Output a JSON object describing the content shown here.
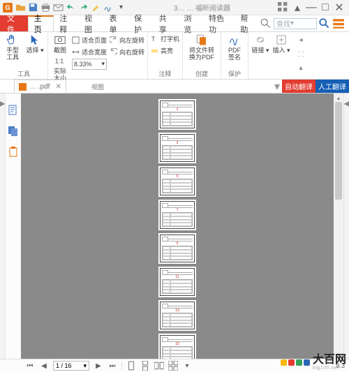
{
  "app": {
    "titleCenter": "3… … 福昕阅读器",
    "logoLetter": "G"
  },
  "quickAccess": [
    "open-icon",
    "save-icon",
    "print-icon",
    "mail-icon",
    "undo-icon",
    "redo-icon",
    "highlight-icon",
    "sign-icon",
    "more-icon"
  ],
  "windowControls": [
    "wc-grid",
    "wc-up",
    "wc-min",
    "wc-max",
    "wc-close"
  ],
  "tabStrip": {
    "file": "文件",
    "tabs": [
      {
        "id": "zhuye",
        "label": "主页",
        "active": true
      },
      {
        "id": "zhushi",
        "label": "注释"
      },
      {
        "id": "shitu",
        "label": "视图"
      },
      {
        "id": "biaodan",
        "label": "表单"
      },
      {
        "id": "baohu",
        "label": "保护"
      },
      {
        "id": "gongxiang",
        "label": "共享"
      },
      {
        "id": "liulan",
        "label": "浏览"
      },
      {
        "id": "tesegn",
        "label": "特色功"
      },
      {
        "id": "bangzhu",
        "label": "帮助"
      }
    ],
    "search": {
      "placeholder": "查找"
    }
  },
  "ribbon": {
    "groups": {
      "tools": {
        "title": "工具",
        "hand": "手型\n工具",
        "select": "选择"
      },
      "view": {
        "title": "视图",
        "snapshot": "截图",
        "actual": "实际\n大小",
        "fitPage": "适合页面",
        "fitWidth": "适合宽度",
        "zoom": "8.33%",
        "rotateLeft": "向左旋转",
        "rotateRight": "向右旋转"
      },
      "comment": {
        "title": "注释",
        "typewriter": "打字机",
        "highlight": "高亮"
      },
      "create": {
        "title": "创建",
        "convert": "将文件转\n换为PDF"
      },
      "protect": {
        "title": "保护",
        "sign": "PDF\n签名"
      },
      "links": {
        "link": "链接"
      },
      "insert": {
        "insert": "插入"
      }
    }
  },
  "docTab": {
    "name": "… .pdf",
    "auto": "自动翻译",
    "manual": "人工翻译"
  },
  "pages": {
    "count": 8,
    "labels": [
      "1",
      "3",
      "5",
      "7",
      "9",
      "11",
      "13",
      "15"
    ]
  },
  "nav": {
    "pageDisplay": "1 / 16",
    "zoomDisplay": "8.3"
  },
  "watermark": {
    "big": "大百网",
    "small": "big100.net"
  }
}
